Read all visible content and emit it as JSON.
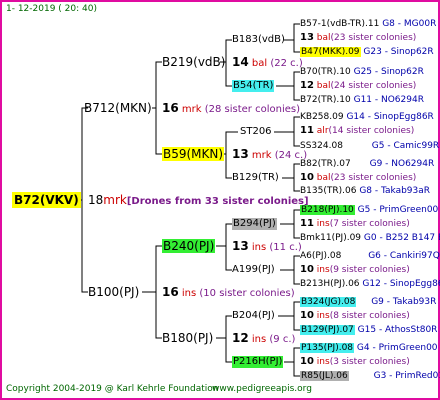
{
  "header": {
    "date": "1- 12-2019 ( 20: 40)"
  },
  "footer": {
    "copyright": "Copyright 2004-2019 @ Karl Kehrle Foundation",
    "site": "www.pedigreeapis.org"
  },
  "root": {
    "label": "B72(VKV)",
    "count": "18",
    "unit": "mrk",
    "note": "[Drones from 33 sister colonies]"
  },
  "gen1": [
    {
      "label": "B712(MKN)",
      "count": "16",
      "unit": "mrk",
      "note": "(28 sister colonies)"
    },
    {
      "label": "B100(PJ)",
      "count": "16",
      "unit": "ins",
      "note": "(10 sister colonies)"
    }
  ],
  "gen2": [
    {
      "label": "B219(vdB)",
      "count": "14",
      "unit": "bal",
      "note": "(22 c.)"
    },
    {
      "label": "B59(MKN)",
      "count": "13",
      "unit": "mrk",
      "note": "(24 c.)"
    },
    {
      "label": "B240(PJ)",
      "count": "13",
      "unit": "ins",
      "note": "(11 c.)"
    },
    {
      "label": "B180(PJ)",
      "count": "12",
      "unit": "ins",
      "note": "(9 c.)"
    }
  ],
  "gen3": [
    {
      "label": "B183(vdB)"
    },
    {
      "label": "B54(TR)"
    },
    {
      "label": "ST206"
    },
    {
      "label": "B129(TR)"
    },
    {
      "label": "B294(PJ)"
    },
    {
      "label": "A199(PJ)"
    },
    {
      "label": "B204(PJ)"
    },
    {
      "label": "P216H(PJ)"
    }
  ],
  "gen4": [
    {
      "parent": "B57-1(vdB-TR).11",
      "code": "G8 - MG00R",
      "count": "13",
      "unit": "bal",
      "note": "(23 sister colonies)",
      "mother": "B47(MKK).09",
      "mcode": "G23 - Sinop62R"
    },
    {
      "parent": "B70(TR).10",
      "code": "G25 - Sinop62R",
      "count": "12",
      "unit": "bal",
      "note": "(24 sister colonies)",
      "mother": "B72(TR).10",
      "mcode": "G11 - NO6294R"
    },
    {
      "parent": "KB258.09",
      "code": "G14 - SinopEgg86R",
      "count": "11",
      "unit": "alr",
      "note": "(14 sister colonies)",
      "mother": "SS324.08",
      "mcode": "G5 - Camic99R"
    },
    {
      "parent": "B82(TR).07",
      "code": "G9 - NO6294R",
      "count": "10",
      "unit": "bal",
      "note": "(23 sister colonies)",
      "mother": "B135(TR).06",
      "mcode": "G8 - Takab93aR"
    },
    {
      "parent": "B218(PJ).10",
      "code": "G5 - PrimGreen00",
      "count": "11",
      "unit": "ins",
      "note": "(7 sister colonies)",
      "mother": "Bmk11(PJ).09",
      "mcode": "G0 - B252 B147 B"
    },
    {
      "parent": "A6(PJ).08",
      "code": "G6 - Cankiri97Q",
      "count": "10",
      "unit": "ins",
      "note": "(9 sister colonies)",
      "mother": "B213H(PJ).06",
      "mcode": "G12 - SinopEgg86R"
    },
    {
      "parent": "B324(JG).08",
      "code": "G9 - Takab93R",
      "count": "10",
      "unit": "ins",
      "note": "(8 sister colonies)",
      "mother": "B129(PJ).07",
      "mcode": "G15 - AthosSt80R"
    },
    {
      "parent": "P135(PJ).08",
      "code": "G4 - PrimGreen00",
      "count": "10",
      "unit": "ins",
      "note": "(3 sister colonies)",
      "mother": "R85(JL).06",
      "mcode": "G3 - PrimRed01"
    }
  ]
}
